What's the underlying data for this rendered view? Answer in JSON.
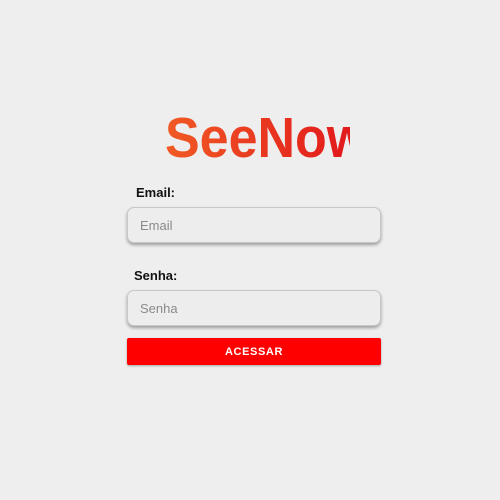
{
  "brand": {
    "logo_text": "SeeNow",
    "logo_gradient_start": "#f15a24",
    "logo_gradient_end": "#e0131b"
  },
  "login_form": {
    "email_label": "Email:",
    "email_placeholder": "Email",
    "email_value": "",
    "password_label": "Senha:",
    "password_placeholder": "Senha",
    "password_value": "",
    "submit_label": "ACESSAR"
  },
  "colors": {
    "background": "#eeeeee",
    "button": "#ff0000",
    "button_text": "#ffffff"
  }
}
